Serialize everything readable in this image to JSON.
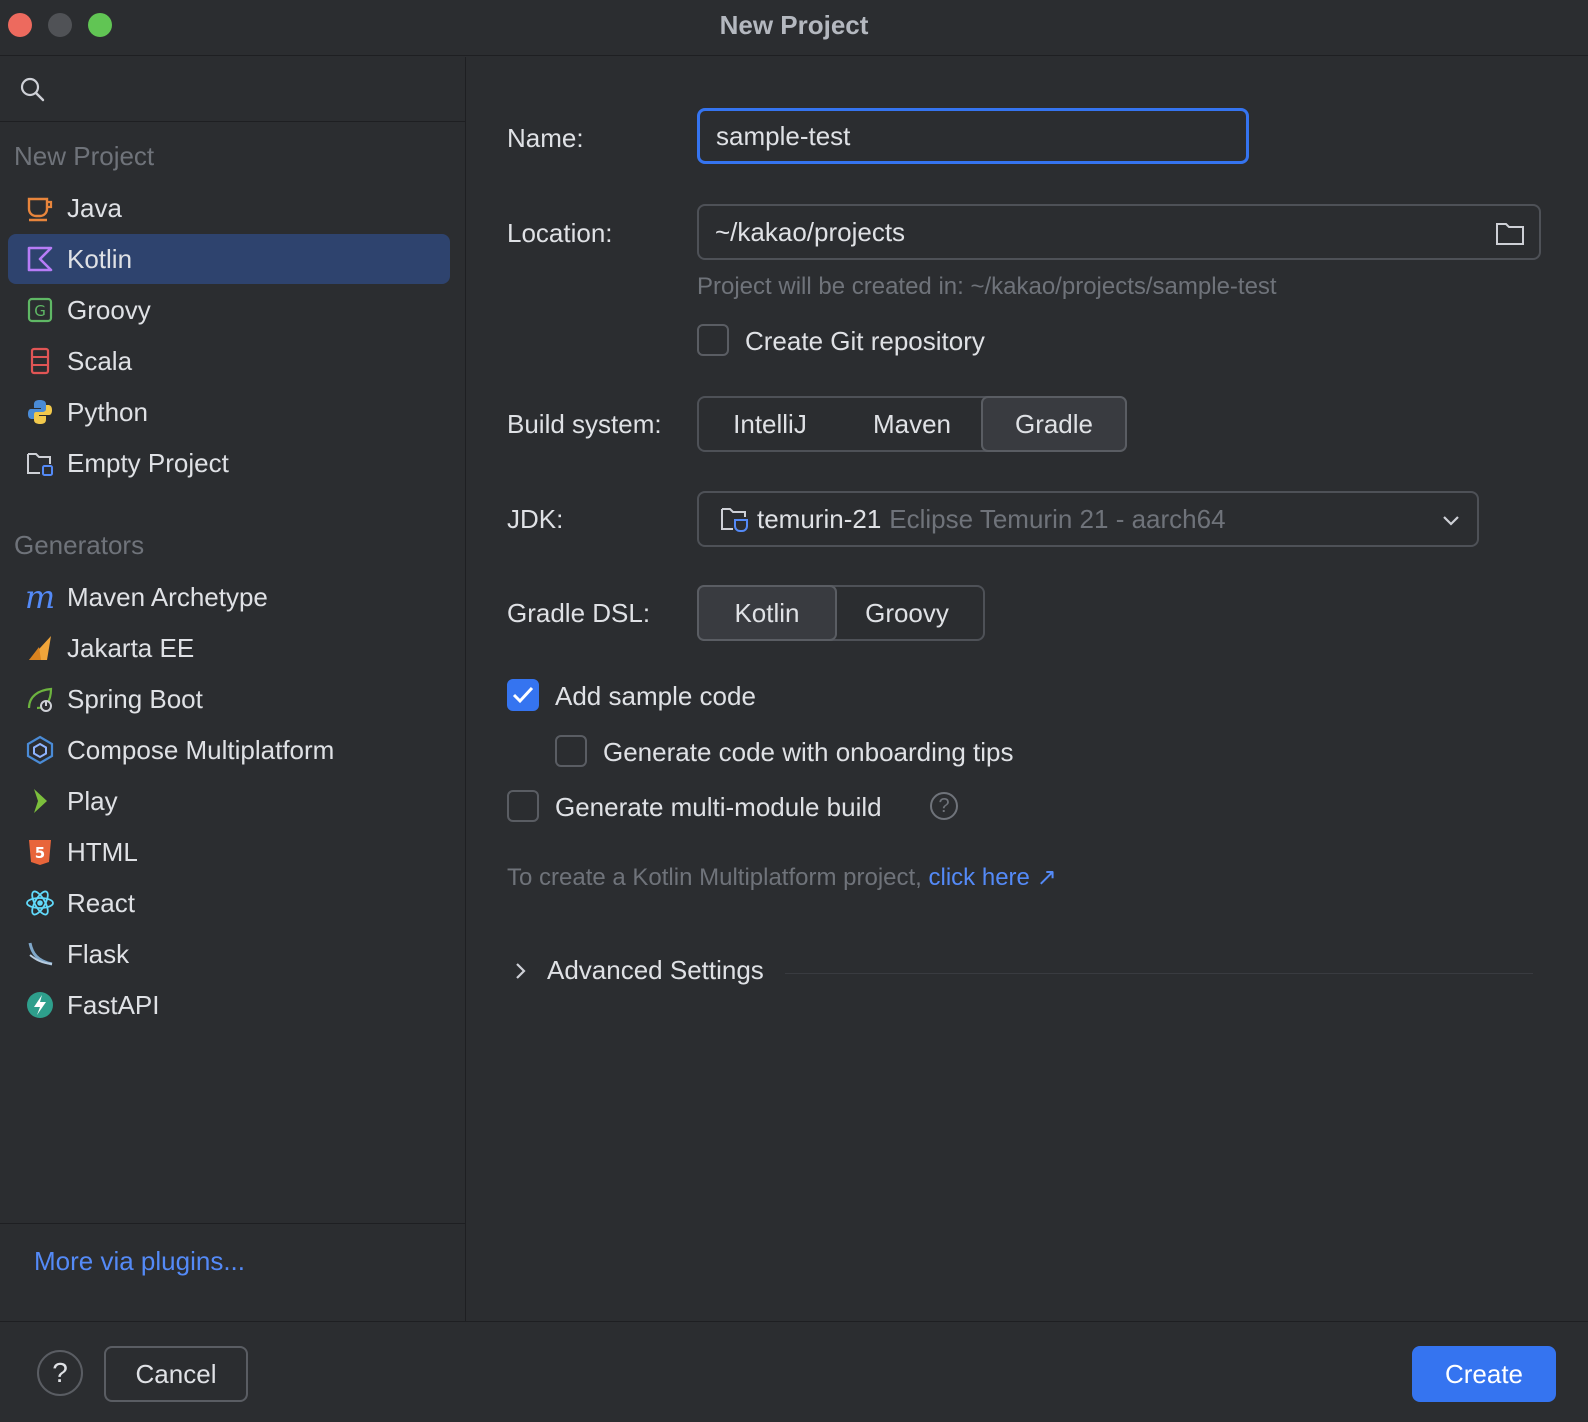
{
  "window": {
    "title": "New Project"
  },
  "sidebar": {
    "search_placeholder": "",
    "new_project_header": "New Project",
    "project_types": [
      {
        "label": "Java",
        "icon": "java-cup-icon"
      },
      {
        "label": "Kotlin",
        "icon": "kotlin-icon",
        "selected": true
      },
      {
        "label": "Groovy",
        "icon": "groovy-icon"
      },
      {
        "label": "Scala",
        "icon": "scala-icon"
      },
      {
        "label": "Python",
        "icon": "python-icon"
      },
      {
        "label": "Empty Project",
        "icon": "empty-project-icon"
      }
    ],
    "generators_header": "Generators",
    "generators": [
      {
        "label": "Maven Archetype",
        "icon": "maven-icon"
      },
      {
        "label": "Jakarta EE",
        "icon": "jakarta-icon"
      },
      {
        "label": "Spring Boot",
        "icon": "spring-boot-icon"
      },
      {
        "label": "Compose Multiplatform",
        "icon": "compose-icon"
      },
      {
        "label": "Play",
        "icon": "play-icon"
      },
      {
        "label": "HTML",
        "icon": "html5-icon"
      },
      {
        "label": "React",
        "icon": "react-icon"
      },
      {
        "label": "Flask",
        "icon": "flask-icon"
      },
      {
        "label": "FastAPI",
        "icon": "fastapi-icon"
      }
    ],
    "more_plugins": "More via plugins..."
  },
  "form": {
    "name_label": "Name:",
    "name_value": "sample-test",
    "location_label": "Location:",
    "location_value": "~/kakao/projects",
    "location_hint": "Project will be created in: ~/kakao/projects/sample-test",
    "git_label": "Create Git repository",
    "git_checked": false,
    "build_system_label": "Build system:",
    "build_systems": [
      "IntelliJ",
      "Maven",
      "Gradle"
    ],
    "build_system_selected": "Gradle",
    "jdk_label": "JDK:",
    "jdk_name": "temurin-21",
    "jdk_detail": "Eclipse Temurin 21 - aarch64",
    "gradle_dsl_label": "Gradle DSL:",
    "gradle_dsl_options": [
      "Kotlin",
      "Groovy"
    ],
    "gradle_dsl_selected": "Kotlin",
    "sample_code_label": "Add sample code",
    "sample_code_checked": true,
    "onboarding_label": "Generate code with onboarding tips",
    "onboarding_checked": false,
    "multimodule_label": "Generate multi-module build",
    "multimodule_checked": false,
    "kmp_text": "To create a Kotlin Multiplatform project,",
    "kmp_link": "click here",
    "advanced_label": "Advanced Settings"
  },
  "footer": {
    "help_glyph": "?",
    "cancel_label": "Cancel",
    "create_label": "Create"
  },
  "colors": {
    "accent": "#3574f0",
    "link": "#548af7",
    "selection": "#2e436e",
    "background": "#2b2d30"
  }
}
